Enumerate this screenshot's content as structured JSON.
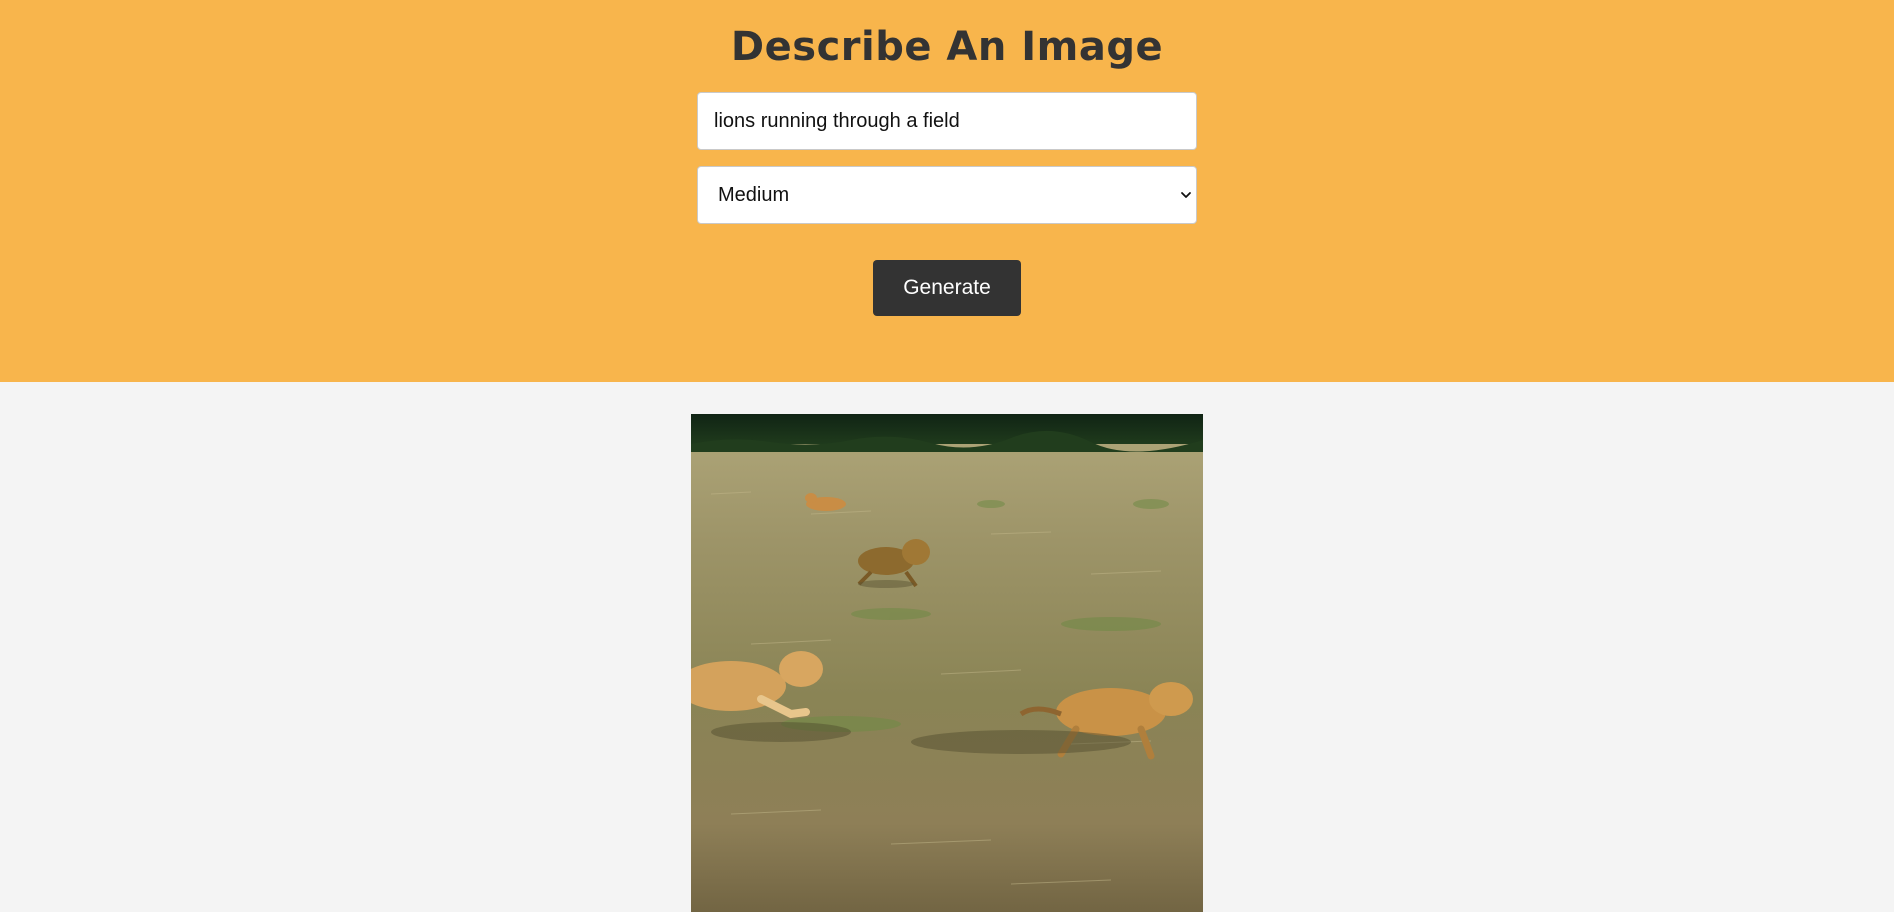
{
  "header": {
    "title": "Describe An Image"
  },
  "form": {
    "prompt_value": "lions running through a field",
    "size_selected": "Medium",
    "generate_label": "Generate"
  },
  "colors": {
    "header_bg": "#f8b54c",
    "page_bg": "#f4f4f4",
    "button_bg": "#333333",
    "title_color": "#333333"
  },
  "result": {
    "image_icon": "generated-image"
  }
}
